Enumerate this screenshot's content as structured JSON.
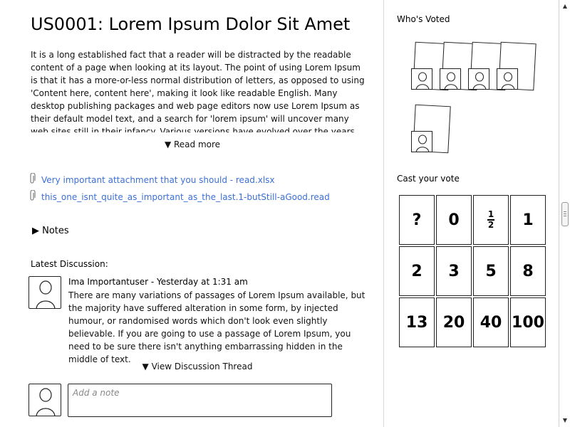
{
  "story": {
    "title": "US0001: Lorem Ipsum Dolor Sit Amet",
    "description": "It is a long established fact that a reader will be distracted by the readable content of a page when looking at its layout. The point of using Lorem Ipsum is that it has a more-or-less normal distribution of letters, as opposed to using 'Content here, content here', making it look like readable English. Many desktop publishing packages and web page editors now use Lorem Ipsum as their default model text, and a search for 'lorem ipsum' will uncover many web sites still in their infancy. Various versions have evolved over the years, sometimes by accident.",
    "read_more": "▼ Read more"
  },
  "attachments": [
    {
      "name": "Very important attachment that you should - read.xlsx",
      "icon": "paperclip-icon"
    },
    {
      "name": "this_one_isnt_quite_as_important_as_the_last.1-butStill-aGood.read",
      "icon": "paperclip-icon"
    }
  ],
  "notes_toggle": "▶ Notes",
  "discussion": {
    "label": "Latest Discussion:",
    "author_line": "Ima Importantuser - Yesterday at 1:31 am",
    "body": "There are many variations of passages of Lorem Ipsum available, but the majority have suffered alteration in some form, by injected humour, or randomised words which don't look even slightly believable. If you are going to use a passage of Lorem Ipsum, you need to be sure there isn't anything embarrassing hidden in the middle of text.",
    "view_thread": "▼ View Discussion Thread"
  },
  "note": {
    "placeholder": "Add a note",
    "value": ""
  },
  "voters": {
    "label": "Who's Voted",
    "count": 5
  },
  "vote": {
    "label": "Cast your vote",
    "cards": [
      "?",
      "0",
      "½",
      "1",
      "2",
      "3",
      "5",
      "8",
      "13",
      "20",
      "40",
      "100"
    ]
  },
  "colors": {
    "link": "#3b6fd6",
    "border": "#222222",
    "divider": "#d8d8d8"
  }
}
